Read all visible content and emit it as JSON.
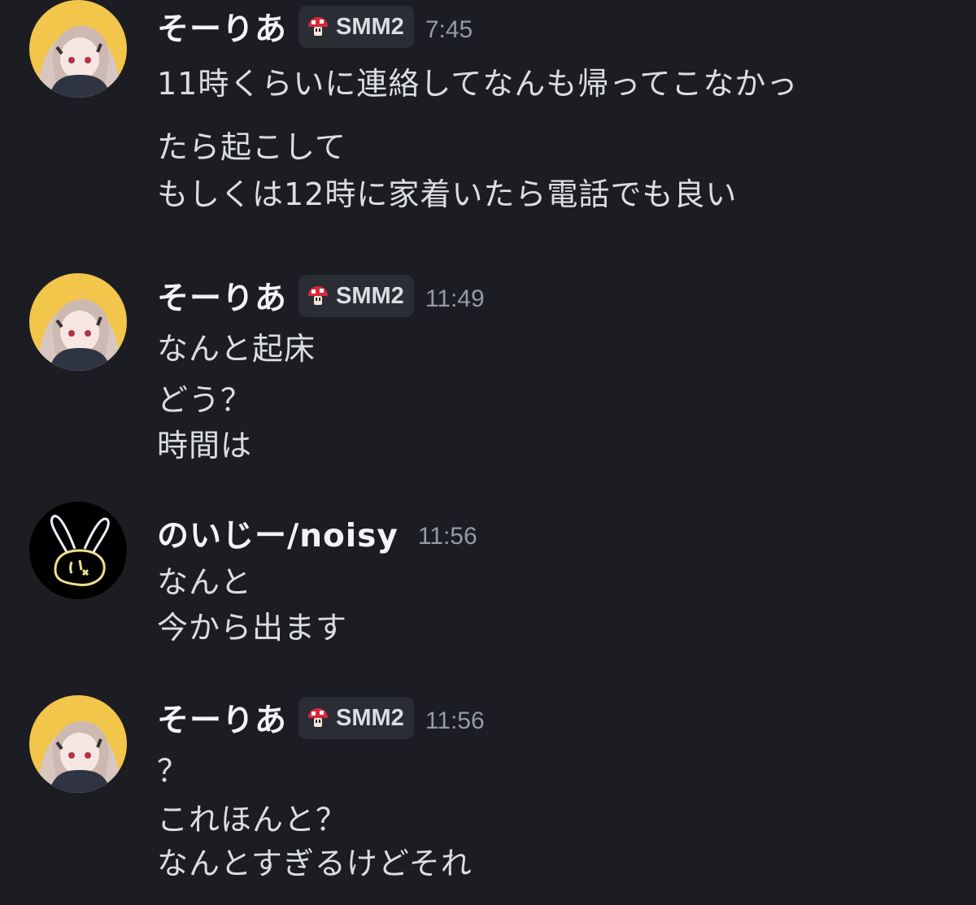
{
  "messages": [
    {
      "username": "そーりあ",
      "tag": {
        "label": "SMM2",
        "icon": "mushroom-icon"
      },
      "time": "7:45",
      "avatar": "anime-girl-avatar",
      "lines": [
        "11時くらいに連絡してなんも帰ってこなかっ",
        "たら起こして",
        "もしくは12時に家着いたら電話でも良い"
      ]
    },
    {
      "username": "そーりあ",
      "tag": {
        "label": "SMM2",
        "icon": "mushroom-icon"
      },
      "time": "11:49",
      "avatar": "anime-girl-avatar",
      "lines": [
        "なんと起床",
        "どう？",
        "時間は"
      ]
    },
    {
      "username": "のいじー/noisy",
      "time": "11:56",
      "avatar": "bunny-doodle-avatar",
      "lines": [
        "なんと",
        "今から出ます"
      ]
    },
    {
      "username": "そーりあ",
      "tag": {
        "label": "SMM2",
        "icon": "mushroom-icon"
      },
      "time": "11:56",
      "avatar": "anime-girl-avatar",
      "lines": [
        "？",
        "これほんと？",
        "なんとすぎるけどそれ"
      ]
    }
  ],
  "colors": {
    "background": "#1c1d22",
    "username": "#f2f3f5",
    "message_text": "#dbdee1",
    "timestamp": "#949ba4",
    "tag_background": "#2b2d35",
    "mushroom_red": "#d8283a",
    "avatar_yellow": "#f2c54b",
    "bunny_outline": "#eaf0ff",
    "bunny_face": "#f0e08a"
  }
}
